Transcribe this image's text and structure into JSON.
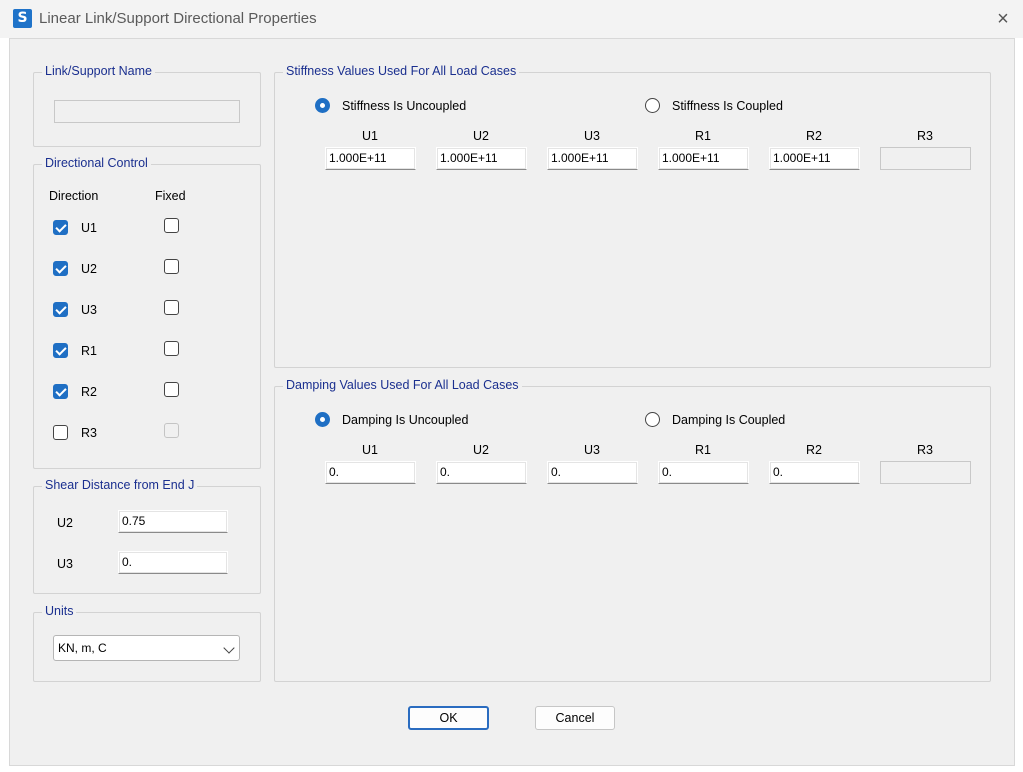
{
  "window": {
    "title": "Linear Link/Support Directional Properties",
    "app_icon": "S",
    "close_icon": "×"
  },
  "link_support_name": {
    "legend": "Link/Support Name",
    "value": ""
  },
  "directional_control": {
    "legend": "Directional Control",
    "col_direction": "Direction",
    "col_fixed": "Fixed",
    "rows": [
      {
        "label": "U1",
        "checked": true,
        "fixed": false,
        "fixed_enabled": true
      },
      {
        "label": "U2",
        "checked": true,
        "fixed": false,
        "fixed_enabled": true
      },
      {
        "label": "U3",
        "checked": true,
        "fixed": false,
        "fixed_enabled": true
      },
      {
        "label": "R1",
        "checked": true,
        "fixed": false,
        "fixed_enabled": true
      },
      {
        "label": "R2",
        "checked": true,
        "fixed": false,
        "fixed_enabled": true
      },
      {
        "label": "R3",
        "checked": false,
        "fixed": false,
        "fixed_enabled": false
      }
    ]
  },
  "shear_distance": {
    "legend": "Shear Distance from End J",
    "u2_label": "U2",
    "u2_value": "0.75",
    "u3_label": "U3",
    "u3_value": "0."
  },
  "units": {
    "legend": "Units",
    "selected": "KN, m, C"
  },
  "stiffness": {
    "legend": "Stiffness Values Used For All Load Cases",
    "uncoupled_label": "Stiffness Is Uncoupled",
    "coupled_label": "Stiffness Is Coupled",
    "selected": "uncoupled",
    "columns": [
      "U1",
      "U2",
      "U3",
      "R1",
      "R2",
      "R3"
    ],
    "values": [
      "1.000E+11",
      "1.000E+11",
      "1.000E+11",
      "1.000E+11",
      "1.000E+11",
      ""
    ]
  },
  "damping": {
    "legend": "Damping Values Used For All Load Cases",
    "uncoupled_label": "Damping Is Uncoupled",
    "coupled_label": "Damping Is Coupled",
    "selected": "uncoupled",
    "columns": [
      "U1",
      "U2",
      "U3",
      "R1",
      "R2",
      "R3"
    ],
    "values": [
      "0.",
      "0.",
      "0.",
      "0.",
      "0.",
      ""
    ]
  },
  "buttons": {
    "ok": "OK",
    "cancel": "Cancel"
  },
  "colors": {
    "accent": "#1f6fc4",
    "legend_text": "#1a2f8f",
    "dialog_bg": "#f0f0f0"
  }
}
